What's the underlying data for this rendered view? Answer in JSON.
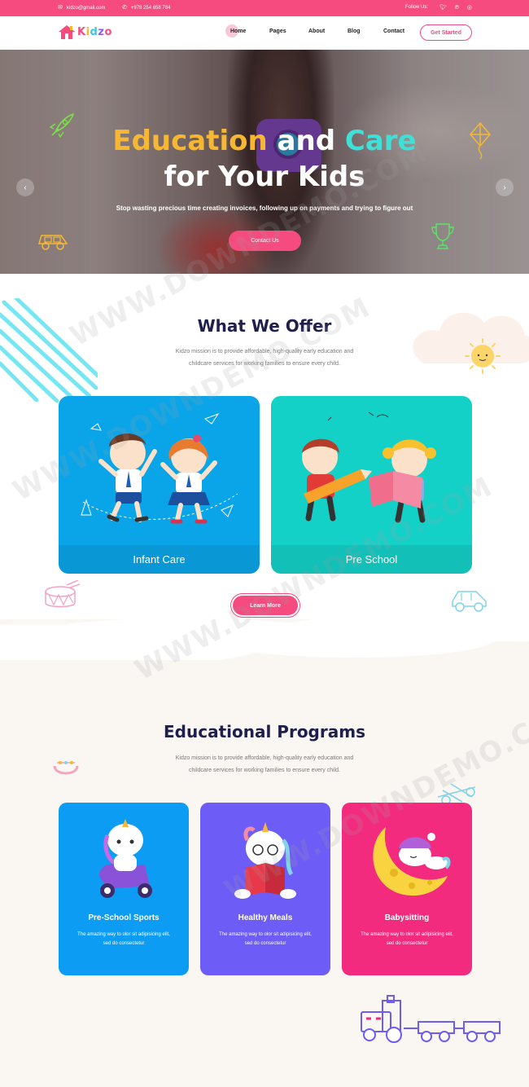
{
  "topbar": {
    "email": "kidzo@gmail.com",
    "phone": "+978 254 658 784",
    "follow_label": "Follow Us:",
    "social_icons": [
      "twitter-icon",
      "pinterest-icon",
      "instagram-icon"
    ]
  },
  "header": {
    "logo_text": "Kidzo",
    "nav": [
      "Home",
      "Pages",
      "About",
      "Blog",
      "Contact"
    ],
    "active_nav": "Home",
    "cta": "Get Started"
  },
  "hero": {
    "title_word1": "Education",
    "title_word2": "and",
    "title_word3": "Care",
    "title_line2": "for Your Kids",
    "subtitle": "Stop wasting precious time creating invoices, following up on payments and trying to figure out",
    "button": "Contact Us",
    "prev_arrow": "‹",
    "next_arrow": "›"
  },
  "offer": {
    "title": "What We Offer",
    "text_line1": "Kidzo mission is to provide affordable, high-quality early education and",
    "text_line2": "childcare services for working families to ensure every child.",
    "cards": [
      {
        "label": "Infant Care",
        "color": "#0aa5e8"
      },
      {
        "label": "Pre School",
        "color": "#14d1c8"
      }
    ],
    "button": "Learn More"
  },
  "programs": {
    "title": "Educational Programs",
    "text_line1": "Kidzo mission is to provide affordable, high-quality early education and",
    "text_line2": "childcare services for working families to ensure every child.",
    "cards": [
      {
        "title": "Pre-School Sports",
        "text": "The amazing way to olor sit adipisicing elit, sed do consectetur",
        "color": "#0d9cf3"
      },
      {
        "title": "Healthy Meals",
        "text": "The amazing way to olor sit adipisicing elit, sed do consectetur",
        "color": "#6e5cf6"
      },
      {
        "title": "Babysitting",
        "text": "The amazing way to olor sit adipisicing elit, sed do consectetur",
        "color": "#f32b7e"
      }
    ]
  },
  "watermark": "WWW.DOWNDEMO.COM",
  "colors": {
    "accent": "#f54b7e",
    "navy": "#1e1f4b"
  }
}
